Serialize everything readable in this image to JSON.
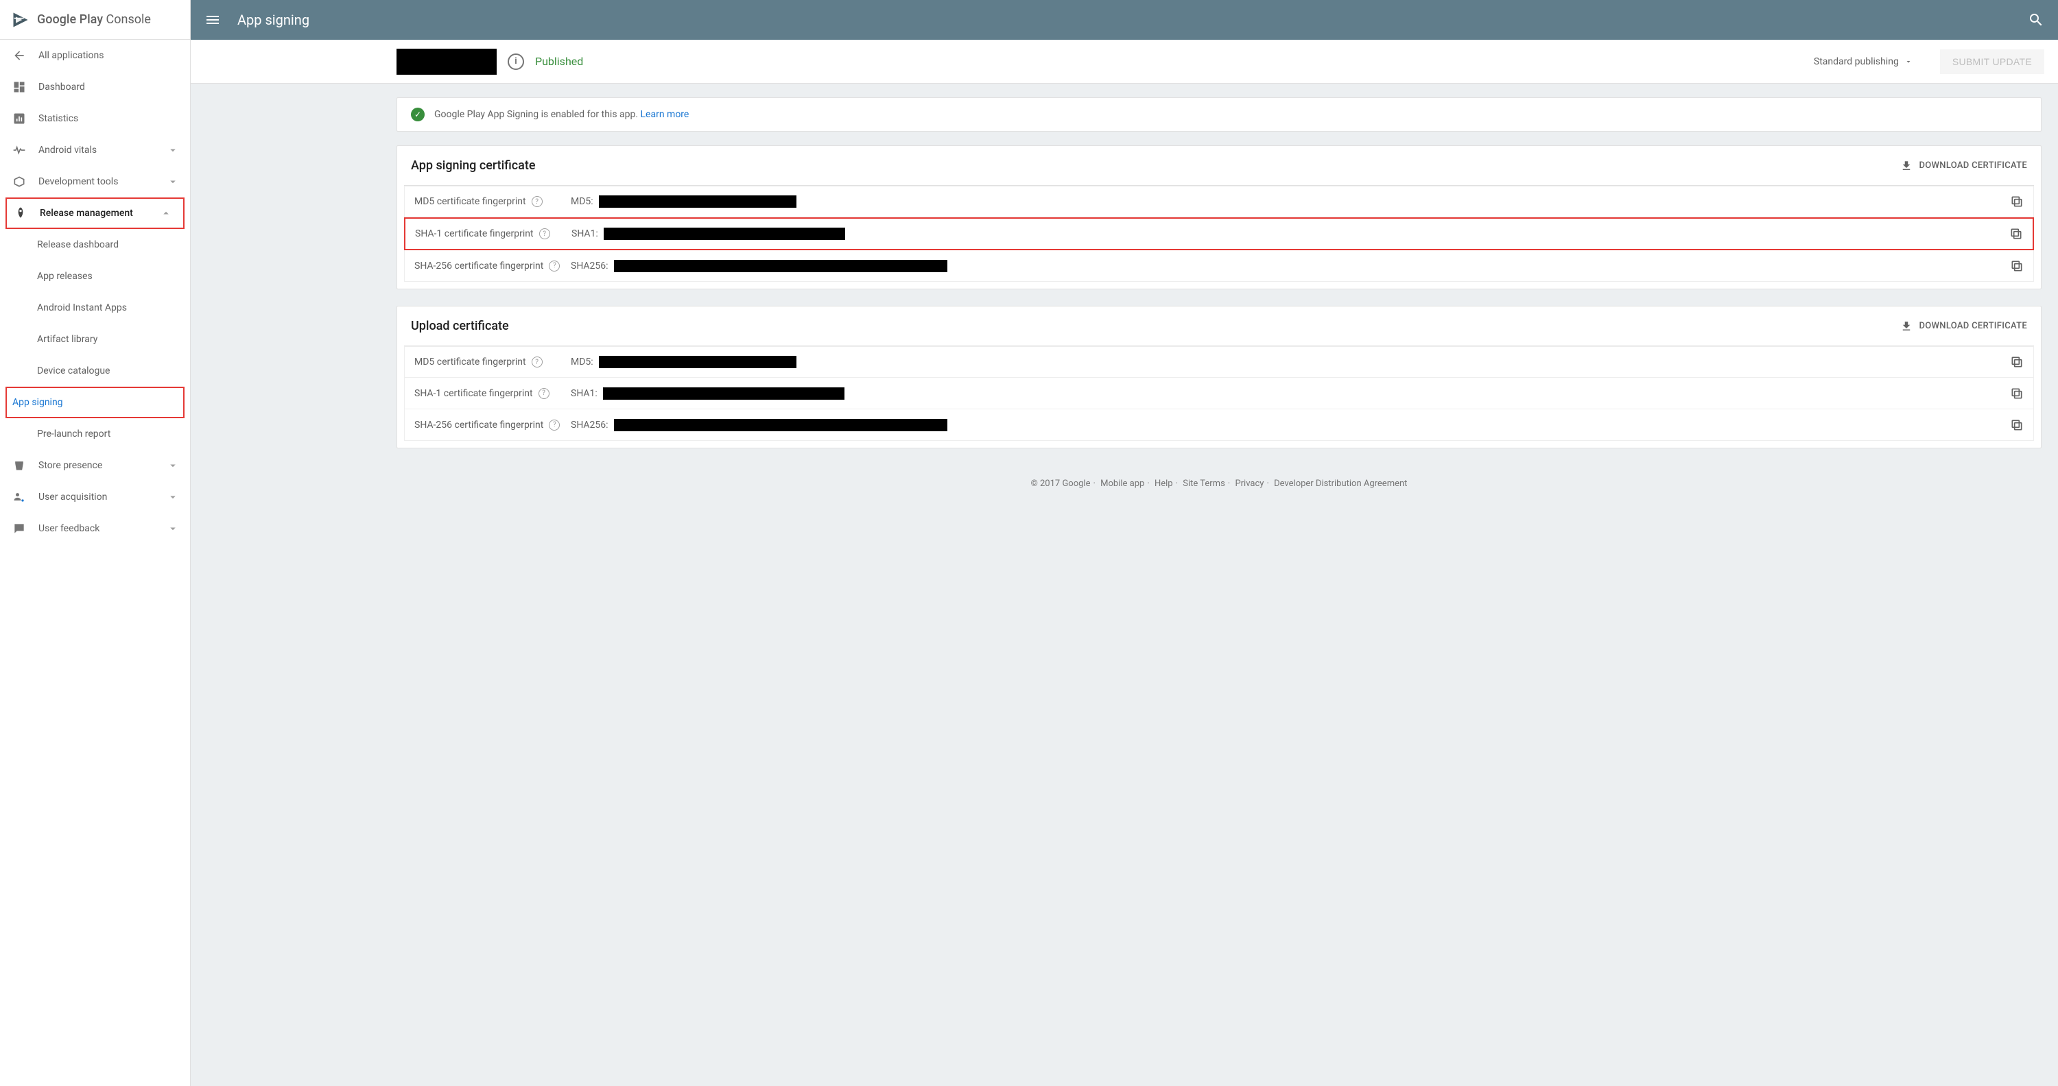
{
  "brand": {
    "name1": "Google Play",
    "name2": " Console"
  },
  "sidebar": {
    "all_apps": "All applications",
    "dashboard": "Dashboard",
    "statistics": "Statistics",
    "android_vitals": "Android vitals",
    "dev_tools": "Development tools",
    "release_mgmt": "Release management",
    "release_dashboard": "Release dashboard",
    "app_releases": "App releases",
    "instant_apps": "Android Instant Apps",
    "artifact_library": "Artifact library",
    "device_catalogue": "Device catalogue",
    "app_signing": "App signing",
    "prelaunch": "Pre-launch report",
    "store_presence": "Store presence",
    "user_acquisition": "User acquisition",
    "user_feedback": "User feedback"
  },
  "topbar": {
    "title": "App signing"
  },
  "subheader": {
    "status": "Published",
    "publishing_mode": "Standard publishing",
    "submit": "SUBMIT UPDATE"
  },
  "info": {
    "text": "Google Play App Signing is enabled for this app. ",
    "learn": "Learn more"
  },
  "card1": {
    "title": "App signing certificate",
    "download": "DOWNLOAD CERTIFICATE",
    "rows": {
      "md5_label": "MD5 certificate fingerprint",
      "md5_prefix": "MD5:",
      "sha1_label": "SHA-1 certificate fingerprint",
      "sha1_prefix": "SHA1:",
      "sha256_label": "SHA-256 certificate fingerprint",
      "sha256_prefix": "SHA256:"
    }
  },
  "card2": {
    "title": "Upload certificate",
    "download": "DOWNLOAD CERTIFICATE",
    "rows": {
      "md5_label": "MD5 certificate fingerprint",
      "md5_prefix": "MD5:",
      "sha1_label": "SHA-1 certificate fingerprint",
      "sha1_prefix": "SHA1:",
      "sha256_label": "SHA-256 certificate fingerprint",
      "sha256_prefix": "SHA256:"
    }
  },
  "footer": {
    "copyright": "© 2017 Google",
    "mobile": "Mobile app",
    "help": "Help",
    "terms": "Site Terms",
    "privacy": "Privacy",
    "dda": "Developer Distribution Agreement"
  }
}
